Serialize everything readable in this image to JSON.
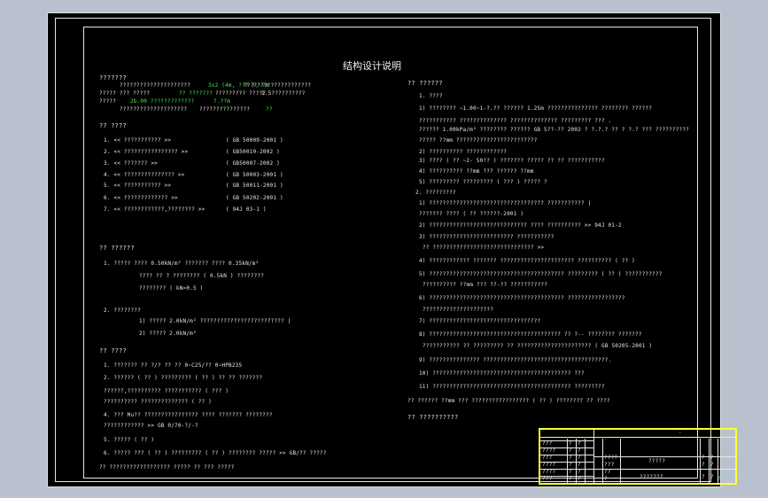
{
  "drawing": {
    "title": "结构设计说明",
    "left_column": [
      {
        "text": "???????",
        "cls": "h"
      },
      {
        "text": "?????????????????????"
      },
      {
        "text": "3x2 (4m, ??? ), ?m",
        "cls": "g"
      },
      {
        "text": "????????????????????"
      },
      {
        "text": "?????  ??? ?????"
      },
      {
        "text": "?? ???????",
        "cls": "g"
      },
      {
        "text": "?????????  ?????"
      },
      {
        "text": "1.5??????????"
      },
      {
        "text": "?????"
      },
      {
        "text": "2b.00 ?????????????",
        "cls": "g"
      },
      {
        "text": "?.??m",
        "cls": "g"
      },
      {
        "text": "????????????????????"
      },
      {
        "text": "???????????????"
      },
      {
        "text": "??",
        "cls": "g"
      },
      {
        "text": "?? ????",
        "cls": "h"
      },
      {
        "text": "1. << ???????????  >>"
      },
      {
        "text": "( GB 50009-2001 )"
      },
      {
        "text": "2. << ????????????????  >>"
      },
      {
        "text": "( GB50010-2002 )"
      },
      {
        "text": "3. << ???????  >>"
      },
      {
        "text": "( GB50007-2002 )"
      },
      {
        "text": "4. << ???????????????  >>"
      },
      {
        "text": "( GB 50003-2001 )"
      },
      {
        "text": "5. << ???????????  >>"
      },
      {
        "text": "( GB 50011-2001 )"
      },
      {
        "text": "6. << ?????????????  >>"
      },
      {
        "text": "( GB 50202-2001 )"
      },
      {
        "text": "7. << ????????????,????????  >>"
      },
      {
        "text": "( 94J 03-1 )"
      },
      {
        "text": "?? ??????",
        "cls": "h"
      },
      {
        "text": "1. ?????   ????   0.50kN/m²   ???????   ????   0.35kN/m²"
      },
      {
        "text": "????  ?? ? ????????   ( 0.5kN )   ????????"
      },
      {
        "text": "????????   ( kN=0.5 )"
      },
      {
        "text": "2. ????????"
      },
      {
        "text": "1) ?????   2.0kN/m² ?????????????????????????   |"
      },
      {
        "text": "2) ?????   2.0kN/m²"
      },
      {
        "text": "?? ????",
        "cls": "h"
      },
      {
        "text": "1. ???????  ??   ?/?  ?? ??  0~C25/?? 0~HPB235"
      },
      {
        "text": "2. ??????   ( ?? )   ?????????   ( ?? )   ?? ??   ???????"
      },
      {
        "text": "??????,??????????  ???????????   ( ??? )"
      },
      {
        "text": "??????????   ??????????????   ( ?? )"
      },
      {
        "text": "4. ???  Mu?? ????????????????   ????   ???????   ????????"
      },
      {
        "text": "????????????    >> GB 0/70-?/-?"
      },
      {
        "text": "5. ?????  ( ?? )"
      },
      {
        "text": "6. ?????  ???   ( ?? )   ?????????   ( ?? )   ????????   ????? >> GB/?? ?????"
      },
      {
        "text": "?? ??????????????????   ?????   ?? ???   ?????"
      }
    ],
    "right_column": [
      {
        "text": "?? ??????",
        "cls": "h"
      },
      {
        "text": "1. ????"
      },
      {
        "text": "1) ????????   ~1.00~1-?.?? ??????   1.25m ???????????????   ????????  ??????"
      },
      {
        "text": "???????????   ??????????????   ??????????????  ?????????   ??? ."
      },
      {
        "text": "??????   1.00kPa/m²  ????????   ??????   GB 5??-?? 2002 ?  ?.?.?  ??  ?  ?.? ??? ??????????"
      },
      {
        "text": "?????   ??mm  ????????????????????????"
      },
      {
        "text": "2) ??????????   ????????????"
      },
      {
        "text": "3) ????   ( ?? ~2- 50?? )   ??????? ?????   ?? ?? ???????????"
      },
      {
        "text": "4) ??????????   ??mm  ??? ??????   ??mm"
      },
      {
        "text": "5) ?????????   ?????????   ( ??? )   ????? ?"
      },
      {
        "text": "2. ?????????"
      },
      {
        "text": "1) ??????????????????????????????????  ???????????   |"
      },
      {
        "text": "???????   ????   ( ?? ??????-2001 )"
      },
      {
        "text": "2) ?????????????????????????????  ????   ??????????   >> 94J 01-2"
      },
      {
        "text": "3) ?????????????????????????    ???????????"
      },
      {
        "text": "??  ??????????????????????????????    >>"
      },
      {
        "text": "4) ????????????   ???????  ??????????????????????   ??????????   ( ?? )"
      },
      {
        "text": "5) ????????????????????????????????????????   ?????????   ( ?? )   ???????????"
      },
      {
        "text": "??????????   ??mm  ???   ??-?? ???????????"
      },
      {
        "text": "6) ????????????????????????????????????????   ?????????????????"
      },
      {
        "text": "?????????????????????"
      },
      {
        "text": "7) ?????????????????????????????????"
      },
      {
        "text": "8) ???????????????????????????????????????   ??  ?--  ????????   ???????"
      },
      {
        "text": "???????????   ?? ?????????  ?? ??????????????????????   ( GB 50205-2001 )"
      },
      {
        "text": "9) ???????????????   ?????????????????????????????????????."
      },
      {
        "text": "10) ?????????????????????????????????????????   ???"
      },
      {
        "text": "11) ?????????????????????????????????????????   ?????????"
      },
      {
        "text": "?? ??????   ??mm  ???   ?????????????????   ( ?? )   ????????   ?? ????"
      },
      {
        "text": "?? ??????????",
        "cls": "h"
      }
    ],
    "title_block": {
      "top_mark": "·",
      "cells": [
        {
          "text": "???"
        },
        {
          "text": "?"
        },
        {
          "text": "?"
        },
        {
          "text": "????"
        },
        {
          "text": "?"
        },
        {
          "text": "?"
        },
        {
          "text": "????"
        },
        {
          "text": "?????"
        },
        {
          "text": "?"
        },
        {
          "text": "?"
        },
        {
          "text": "???"
        },
        {
          "text": "?"
        },
        {
          "text": "?"
        },
        {
          "text": "????"
        },
        {
          "text": "?"
        },
        {
          "text": "?"
        },
        {
          "text": "???"
        },
        {
          "text": "?"
        },
        {
          "text": "?"
        },
        {
          "text": "????"
        },
        {
          "text": "?"
        },
        {
          "text": "?"
        },
        {
          "text": "???"
        },
        {
          "text": "?"
        },
        {
          "text": "?"
        },
        {
          "text": "?"
        },
        {
          "text": "???????"
        },
        {
          "text": "?"
        },
        {
          "text": "?"
        },
        {
          "text": "??"
        },
        {
          "text": "?-?"
        }
      ]
    },
    "colors": {
      "background": "#000000",
      "workspace": "#b8c1cd",
      "line": "#e6e6e6",
      "title_block": "#ffff33",
      "highlight": "#4ff04f",
      "accent": "#33ffff"
    }
  }
}
